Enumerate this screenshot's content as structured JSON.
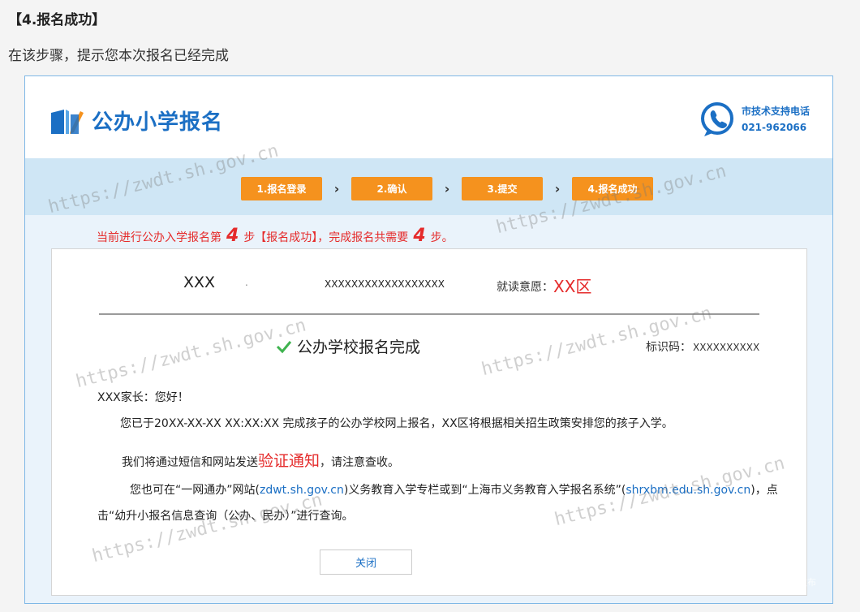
{
  "doc": {
    "heading": "【4.报名成功】",
    "description": "在该步骤，提示您本次报名已经完成"
  },
  "header": {
    "title": "公办小学报名",
    "support_label": "市技术支持电话",
    "support_phone": "021-962066"
  },
  "steps": [
    {
      "label": "1.报名登录"
    },
    {
      "label": "2.确认"
    },
    {
      "label": "3.提交"
    },
    {
      "label": "4.报名成功"
    }
  ],
  "step_arrow": "›",
  "notice": {
    "prefix": "当前进行公办入学报名第",
    "current_step": "4",
    "middle": "步【报名成功】，完成报名共需要",
    "total_steps": "4",
    "suffix": "步。"
  },
  "card": {
    "name": "XXX",
    "dot": ".",
    "id_number": "XXXXXXXXXXXXXXXXXX",
    "preference_label": "就读意愿：",
    "preference_value": "XX区",
    "done_text": "公办学校报名完成",
    "code_label": "标识码：",
    "code_value": "XXXXXXXXXX",
    "greeting": "XXX家长：您好！",
    "para1": "您已于20XX-XX-XX XX:XX:XX 完成孩子的公办学校网上报名，XX区将根据相关招生政策安排您的孩子入学。",
    "para2_pre": "我们将通过短信和网站发送",
    "para2_highlight": "验证通知",
    "para2_post": "，请注意查收。",
    "para3_a": "您也可在“一网通办”网站(",
    "para3_link1": "zdwt.sh.gov.cn",
    "para3_b": ")义务教育入学专栏或到“上海市义务教育入学报名系统”(",
    "para3_link2": "shrxbm.edu.sh.gov.cn",
    "para3_c": ")，点",
    "para3_line2": "击“幼升小报名信息查询（公办、民办）”进行查询。",
    "close_label": "关闭"
  },
  "watermark": "https://zwdt.sh.gov.cn",
  "corner_tag": "上海发布",
  "colors": {
    "accent_blue": "#1b6fc4",
    "step_orange": "#f5921e",
    "alert_red": "#e52b2b"
  }
}
